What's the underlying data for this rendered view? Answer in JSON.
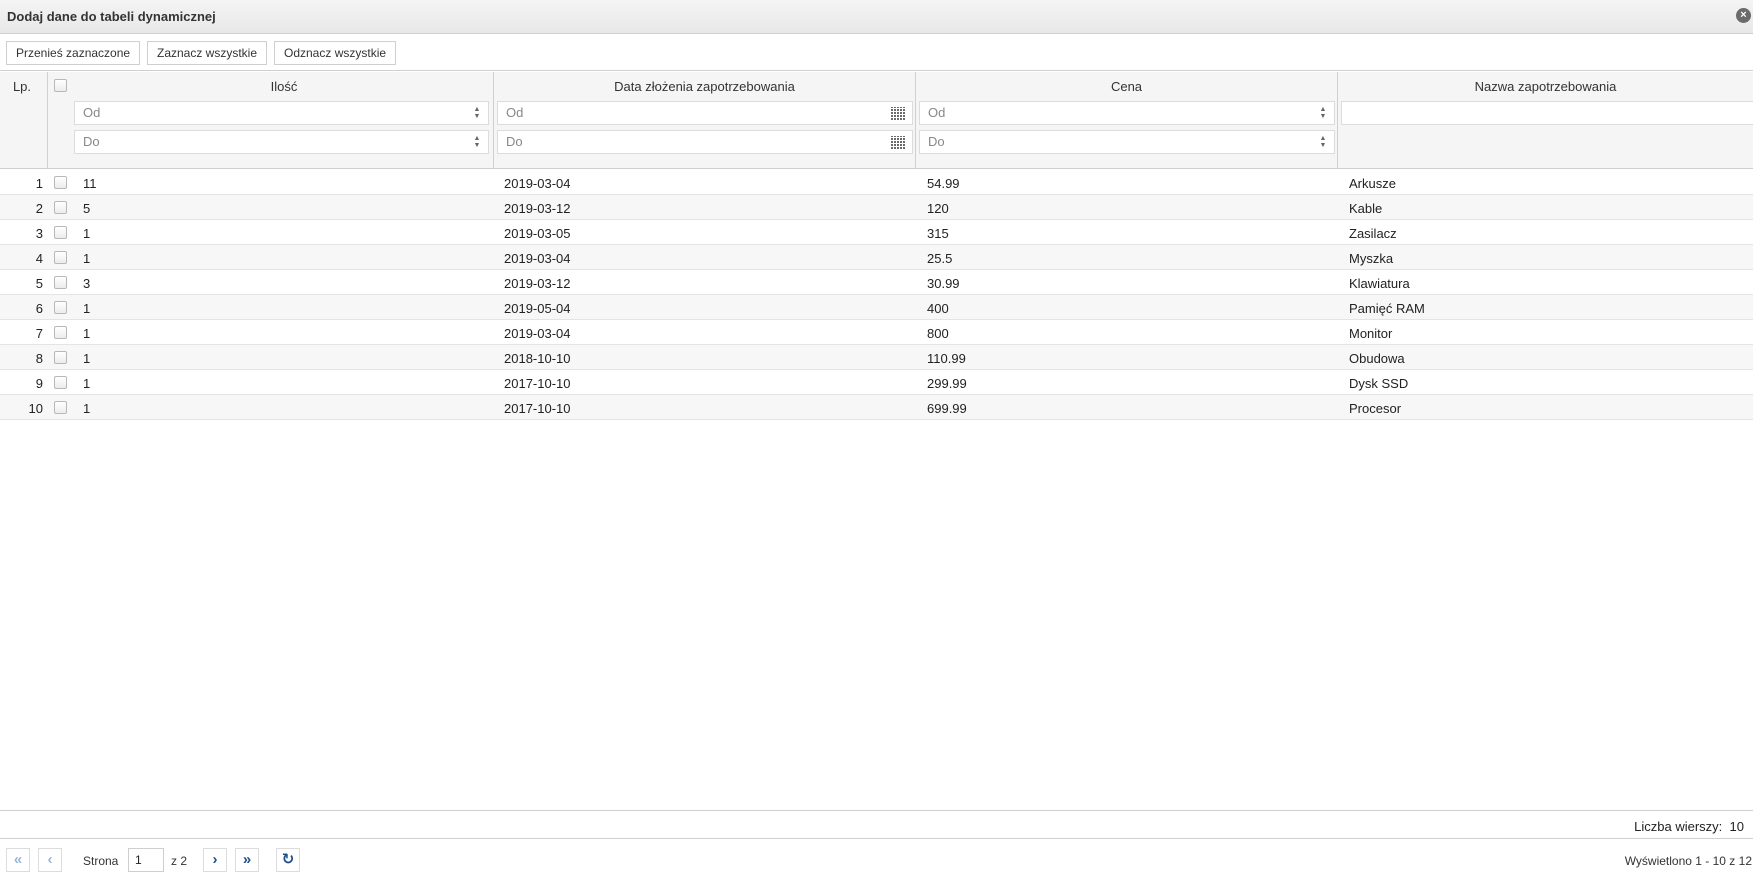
{
  "window": {
    "title": "Dodaj dane do tabeli dynamicznej",
    "close_icon": "×"
  },
  "toolbar": {
    "move_selected": "Przenieś zaznaczone",
    "select_all": "Zaznacz wszystkie",
    "deselect_all": "Odznacz wszystkie"
  },
  "table": {
    "headers": {
      "lp": "Lp.",
      "qty": "Ilość",
      "date": "Data złożenia zapotrzebowania",
      "price": "Cena",
      "name": "Nazwa zapotrzebowania"
    },
    "filters": {
      "from_placeholder": "Od",
      "to_placeholder": "Do"
    },
    "rows": [
      {
        "lp": "1",
        "qty": "11",
        "date": "2019-03-04",
        "price": "54.99",
        "name": "Arkusze"
      },
      {
        "lp": "2",
        "qty": "5",
        "date": "2019-03-12",
        "price": "120",
        "name": "Kable"
      },
      {
        "lp": "3",
        "qty": "1",
        "date": "2019-03-05",
        "price": "315",
        "name": "Zasilacz"
      },
      {
        "lp": "4",
        "qty": "1",
        "date": "2019-03-04",
        "price": "25.5",
        "name": "Myszka"
      },
      {
        "lp": "5",
        "qty": "3",
        "date": "2019-03-12",
        "price": "30.99",
        "name": "Klawiatura"
      },
      {
        "lp": "6",
        "qty": "1",
        "date": "2019-05-04",
        "price": "400",
        "name": "Pamięć RAM"
      },
      {
        "lp": "7",
        "qty": "1",
        "date": "2019-03-04",
        "price": "800",
        "name": "Monitor"
      },
      {
        "lp": "8",
        "qty": "1",
        "date": "2018-10-10",
        "price": "110.99",
        "name": "Obudowa"
      },
      {
        "lp": "9",
        "qty": "1",
        "date": "2017-10-10",
        "price": "299.99",
        "name": "Dysk SSD"
      },
      {
        "lp": "10",
        "qty": "1",
        "date": "2017-10-10",
        "price": "699.99",
        "name": "Procesor"
      }
    ]
  },
  "footer": {
    "row_count_label": "Liczba wierszy:",
    "row_count": "10",
    "page_label": "Strona",
    "page_value": "1",
    "page_of": "z 2",
    "status": "Wyświetlono 1 - 10 z 12",
    "icons": {
      "first": "«",
      "prev": "‹",
      "next": "›",
      "last": "»",
      "refresh": "↻"
    }
  }
}
